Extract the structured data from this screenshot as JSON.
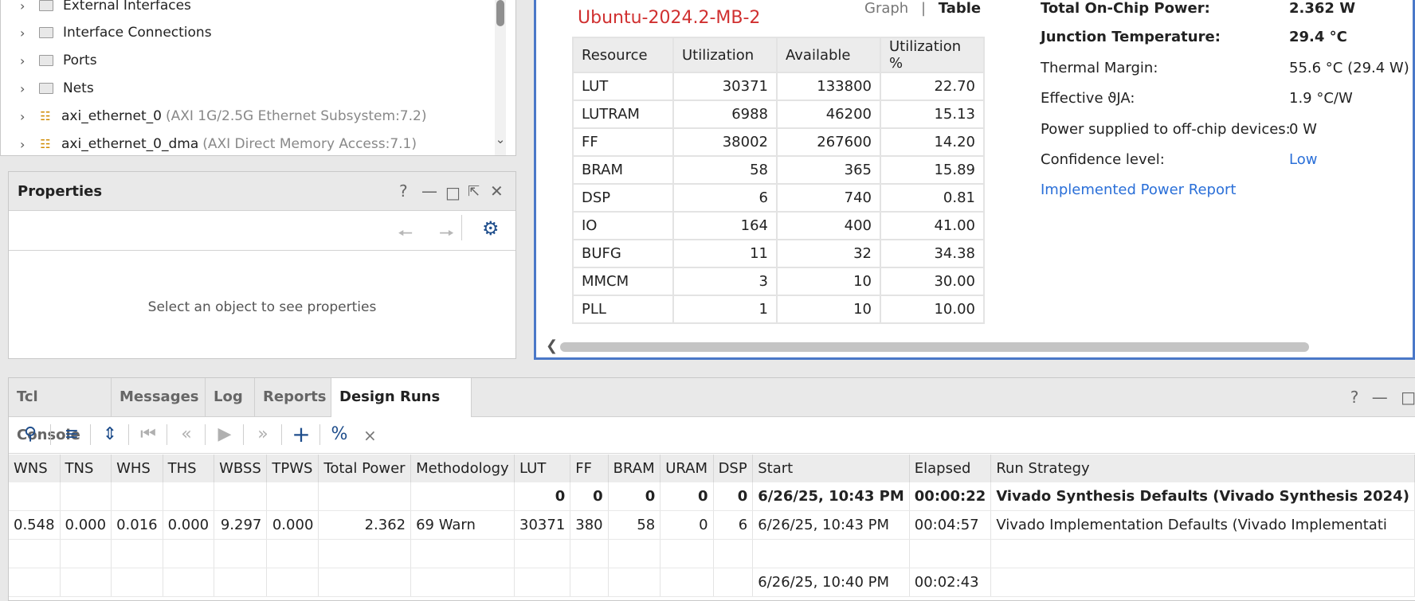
{
  "tree": {
    "items": [
      {
        "label": "External Interfaces",
        "sub": "",
        "icon": "folder-icon"
      },
      {
        "label": "Interface Connections",
        "sub": "",
        "icon": "folder-icon"
      },
      {
        "label": "Ports",
        "sub": "",
        "icon": "folder-icon"
      },
      {
        "label": "Nets",
        "sub": "",
        "icon": "folder-icon"
      },
      {
        "label": "axi_ethernet_0",
        "sub": "(AXI 1G/2.5G Ethernet Subsystem:7.2)",
        "icon": "ip-block-icon"
      },
      {
        "label": "axi_ethernet_0_dma",
        "sub": "(AXI Direct Memory Access:7.1)",
        "icon": "ip-block-icon"
      }
    ]
  },
  "properties": {
    "title": "Properties",
    "help": "?",
    "empty_text": "Select an object to see properties"
  },
  "utilization": {
    "device": "Ubuntu-2024.2-MB-2",
    "view_graph": "Graph",
    "view_sep": "|",
    "view_table": "Table",
    "headers": [
      "Resource",
      "Utilization",
      "Available",
      "Utilization %"
    ],
    "rows": [
      [
        "LUT",
        "30371",
        "133800",
        "22.70"
      ],
      [
        "LUTRAM",
        "6988",
        "46200",
        "15.13"
      ],
      [
        "FF",
        "38002",
        "267600",
        "14.20"
      ],
      [
        "BRAM",
        "58",
        "365",
        "15.89"
      ],
      [
        "DSP",
        "6",
        "740",
        "0.81"
      ],
      [
        "IO",
        "164",
        "400",
        "41.00"
      ],
      [
        "BUFG",
        "11",
        "32",
        "34.38"
      ],
      [
        "MMCM",
        "3",
        "10",
        "30.00"
      ],
      [
        "PLL",
        "1",
        "10",
        "10.00"
      ]
    ]
  },
  "power": {
    "total_label": "Total On-Chip Power:",
    "total_value": "2.362 W",
    "junction_label": "Junction Temperature:",
    "junction_value": "29.4 °C",
    "margin_label": "Thermal Margin:",
    "margin_value": "55.6 °C (29.4 W)",
    "theta_label": "Effective ϑJA:",
    "theta_value": "1.9 °C/W",
    "offchip_label": "Power supplied to off-chip devices:",
    "offchip_value": "0 W",
    "confidence_label": "Confidence level:",
    "confidence_value": "Low",
    "report_link": "Implemented Power Report"
  },
  "runs": {
    "tabs": [
      "Tcl Console",
      "Messages",
      "Log",
      "Reports",
      "Design Runs"
    ],
    "close": "×",
    "help": "?",
    "headers": [
      "WNS",
      "TNS",
      "WHS",
      "THS",
      "WBSS",
      "TPWS",
      "Total Power",
      "Methodology",
      "LUT",
      "FF",
      "BRAM",
      "URAM",
      "DSP",
      "Start",
      "Elapsed",
      "Run Strategy"
    ],
    "rows": [
      [
        "",
        "",
        "",
        "",
        "",
        "",
        "",
        "",
        "0",
        "0",
        "0",
        "0",
        "0",
        "6/26/25, 10:43 PM",
        "00:00:22",
        "Vivado Synthesis Defaults (Vivado Synthesis 2024)"
      ],
      [
        "0.548",
        "0.000",
        "0.016",
        "0.000",
        "9.297",
        "0.000",
        "2.362",
        "69 Warn",
        "30371",
        "380",
        "58",
        "0",
        "6",
        "6/26/25, 10:43 PM",
        "00:04:57",
        "Vivado Implementation Defaults (Vivado Implementati"
      ],
      [
        "",
        "",
        "",
        "",
        "",
        "",
        "",
        "",
        "",
        "",
        "",
        "",
        "",
        "",
        "",
        ""
      ],
      [
        "",
        "",
        "",
        "",
        "",
        "",
        "",
        "",
        "",
        "",
        "",
        "",
        "",
        "6/26/25, 10:40 PM",
        "00:02:43",
        ""
      ]
    ]
  }
}
